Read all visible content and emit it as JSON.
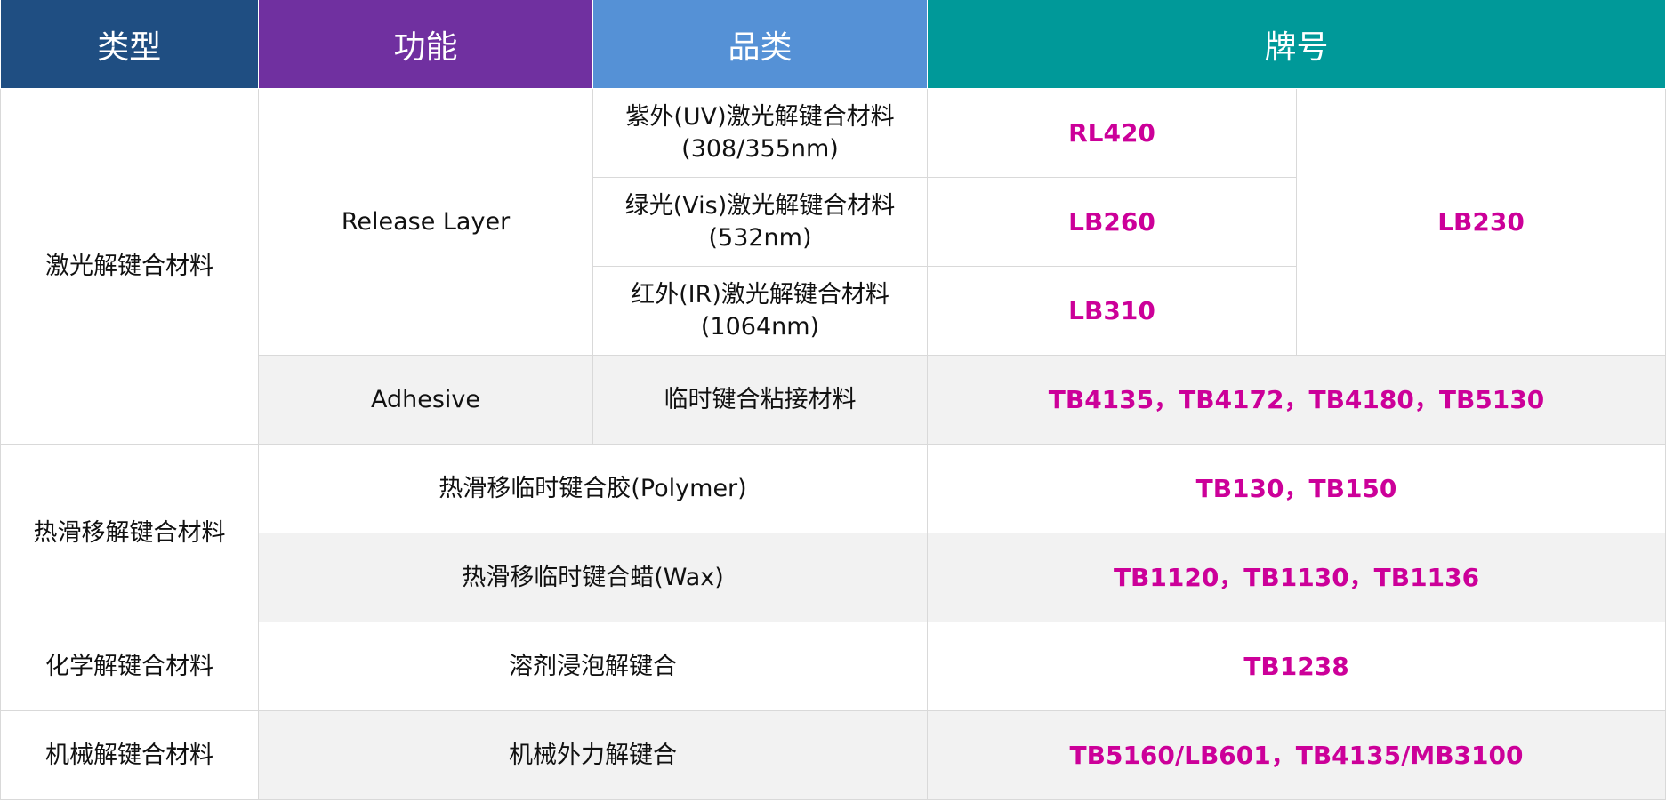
{
  "headers": {
    "type": "类型",
    "function": "功能",
    "category": "品类",
    "brand": "牌号"
  },
  "rows": {
    "laser": {
      "type": "激光解键合材料",
      "release_layer": {
        "function": "Release Layer",
        "uv": {
          "category_line1": "紫外(UV)激光解键合材料",
          "category_line2": "(308/355nm)",
          "brand": "RL420"
        },
        "vis": {
          "category_line1": "绿光(Vis)激光解键合材料",
          "category_line2": "(532nm)",
          "brand": "LB260"
        },
        "ir": {
          "category_line1": "红外(IR)激光解键合材料",
          "category_line2": "(1064nm)",
          "brand": "LB310"
        },
        "shared_brand": "LB230"
      },
      "adhesive": {
        "function": "Adhesive",
        "category": "临时键合粘接材料",
        "brand": "TB4135，TB4172，TB4180，TB5130"
      }
    },
    "thermal": {
      "type": "热滑移解键合材料",
      "polymer": {
        "category": "热滑移临时键合胶(Polymer)",
        "brand": "TB130，TB150"
      },
      "wax": {
        "category": "热滑移临时键合蜡(Wax)",
        "brand": "TB1120，TB1130，TB1136"
      }
    },
    "chemical": {
      "type": "化学解键合材料",
      "category": "溶剂浸泡解键合",
      "brand": "TB1238"
    },
    "mechanical": {
      "type": "机械解键合材料",
      "category": "机械外力解键合",
      "brand": "TB5160/LB601，TB4135/MB3100"
    }
  },
  "colors": {
    "header_type": "#1f4e82",
    "header_function": "#7030a0",
    "header_category": "#5591d6",
    "header_brand": "#009999",
    "brand_text": "#cc0099",
    "alt_row": "#f2f2f2"
  }
}
